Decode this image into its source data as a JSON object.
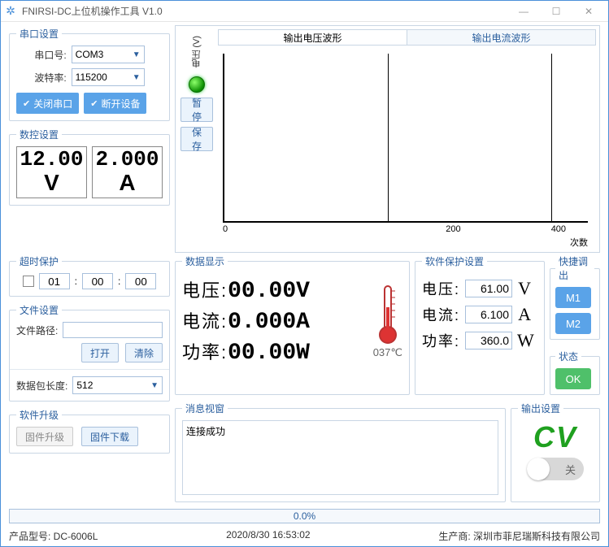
{
  "window": {
    "title": "FNIRSI-DC上位机操作工具 V1.0"
  },
  "serial": {
    "legend": "串口设置",
    "port_label": "串口号:",
    "port_value": "COM3",
    "baud_label": "波特率:",
    "baud_value": "115200",
    "close_btn": "关闭串口",
    "disconnect_btn": "断开设备"
  },
  "nc": {
    "legend": "数控设置",
    "voltage_set": "12.00",
    "current_set": "2.000",
    "v_unit": "V",
    "a_unit": "A"
  },
  "chart": {
    "tab_voltage": "输出电压波形",
    "tab_current": "输出电流波形",
    "ylabel": "电压 (V)",
    "pause": "暂停",
    "save": "保存",
    "x0": "0",
    "x1": "200",
    "x2": "400",
    "xlabel": "次数"
  },
  "chart_data": {
    "type": "line",
    "x": [
      0,
      200,
      400
    ],
    "values": [],
    "title": "输出电压波形",
    "xlabel": "次数",
    "ylabel": "电压 (V)",
    "xlim": [
      0,
      450
    ]
  },
  "timeout": {
    "legend": "超时保护",
    "h": "01",
    "m": "00",
    "s": "00"
  },
  "data_display": {
    "legend": "数据显示",
    "voltage_label": "电压:",
    "voltage_value": "00.00V",
    "current_label": "电流:",
    "current_value": "0.000A",
    "power_label": "功率:",
    "power_value": "00.00W",
    "temp": "037℃"
  },
  "protect": {
    "legend": "软件保护设置",
    "voltage_label": "电压:",
    "voltage_value": "61.00",
    "voltage_unit": "V",
    "current_label": "电流:",
    "current_value": "6.100",
    "current_unit": "A",
    "power_label": "功率:",
    "power_value": "360.0",
    "power_unit": "W"
  },
  "quick": {
    "legend": "快捷调出",
    "m1": "M1",
    "m2": "M2"
  },
  "state": {
    "legend": "状态",
    "ok": "OK"
  },
  "file": {
    "legend": "文件设置",
    "path_label": "文件路径:",
    "open_btn": "打开",
    "clear_btn": "清除",
    "pkt_label": "数据包长度:",
    "pkt_value": "512"
  },
  "msg": {
    "legend": "消息视窗",
    "text": "连接成功"
  },
  "output": {
    "legend": "输出设置",
    "mode": "CV",
    "switch_label": "关"
  },
  "fw": {
    "legend": "软件升级",
    "upgrade_btn": "固件升级",
    "download_btn": "固件下载"
  },
  "progress": {
    "text": "0.0%"
  },
  "status": {
    "model": "产品型号: DC-6006L",
    "datetime": "2020/8/30 16:53:02",
    "vendor": "生产商: 深圳市菲尼瑞斯科技有限公司"
  }
}
